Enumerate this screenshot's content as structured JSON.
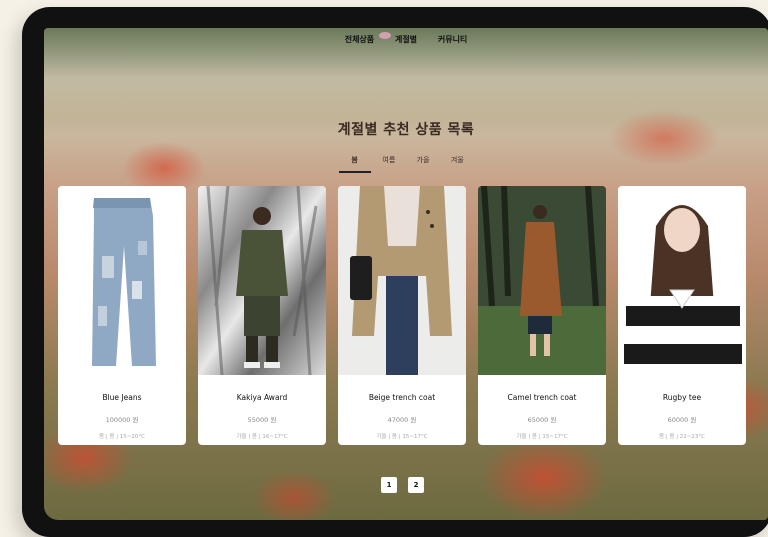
{
  "nav": {
    "items": [
      "전체상품",
      "계절별",
      "커뮤니티"
    ]
  },
  "section": {
    "title": "계절별 추천 상품 목록"
  },
  "tabs": [
    "봄",
    "여름",
    "가을",
    "겨울"
  ],
  "products": [
    {
      "name": "Blue Jeans",
      "price": "100000 원",
      "meta": "봄 | 봄 | 15~20°C"
    },
    {
      "name": "Kakiya Award",
      "price": "55000 원",
      "meta": "가을 | 봄 | 16~17°C"
    },
    {
      "name": "Beige trench coat",
      "price": "47000 원",
      "meta": "가을 | 봄 | 15~17°C"
    },
    {
      "name": "Camel trench coat",
      "price": "65000 원",
      "meta": "가을 | 봄 | 15~17°C"
    },
    {
      "name": "Rugby tee",
      "price": "60000 원",
      "meta": "봄 | 봄 | 22~23°C"
    }
  ],
  "pagination": {
    "pages": [
      "1",
      "2"
    ]
  },
  "colors": {
    "accent": "#222222",
    "card": "#ffffff",
    "poppy": "#d6482e"
  }
}
